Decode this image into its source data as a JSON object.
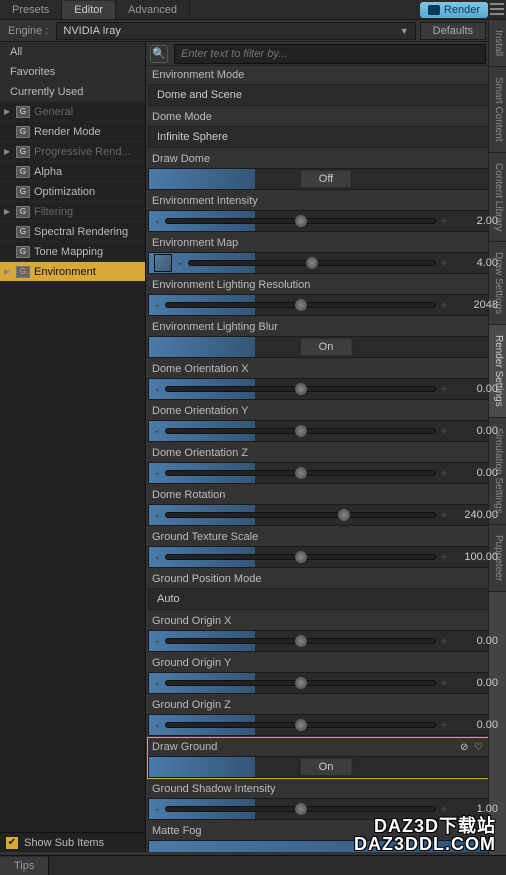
{
  "topTabs": [
    "Presets",
    "Editor",
    "Advanced"
  ],
  "activeTopTab": 1,
  "renderBtn": "Render",
  "engineLabel": "Engine :",
  "engineValue": "NVIDIA Iray",
  "defaultsBtn": "Defaults",
  "sidebar": {
    "headers": [
      "All",
      "Favorites",
      "Currently Used"
    ],
    "items": [
      {
        "label": "General",
        "dim": true,
        "expandable": true
      },
      {
        "label": "Render Mode",
        "dim": false
      },
      {
        "label": "Progressive Rend...",
        "dim": true,
        "expandable": true
      },
      {
        "label": "Alpha",
        "dim": false
      },
      {
        "label": "Optimization",
        "dim": false
      },
      {
        "label": "Filtering",
        "dim": true,
        "expandable": true
      },
      {
        "label": "Spectral Rendering",
        "dim": false
      },
      {
        "label": "Tone Mapping",
        "dim": false
      },
      {
        "label": "Environment",
        "dim": false,
        "selected": true,
        "expandable": true
      }
    ],
    "footerChk": "Show Sub Items"
  },
  "filterPlaceholder": "Enter text to filter by...",
  "params": [
    {
      "type": "select",
      "label": "Environment Mode",
      "value": "Dome and Scene"
    },
    {
      "type": "select",
      "label": "Dome Mode",
      "value": "Infinite Sphere"
    },
    {
      "type": "toggle",
      "label": "Draw Dome",
      "value": "Off"
    },
    {
      "type": "slider",
      "label": "Environment Intensity",
      "value": "2.00",
      "pos": 50
    },
    {
      "type": "slidermap",
      "label": "Environment Map",
      "value": "4.00",
      "pos": 50
    },
    {
      "type": "slider",
      "label": "Environment Lighting Resolution",
      "value": "2048",
      "pos": 50
    },
    {
      "type": "toggle",
      "label": "Environment Lighting Blur",
      "value": "On"
    },
    {
      "type": "slider",
      "label": "Dome Orientation X",
      "value": "0.00",
      "pos": 50
    },
    {
      "type": "slider",
      "label": "Dome Orientation Y",
      "value": "0.00",
      "pos": 50
    },
    {
      "type": "slider",
      "label": "Dome Orientation Z",
      "value": "0.00",
      "pos": 50
    },
    {
      "type": "slider",
      "label": "Dome Rotation",
      "value": "240.00",
      "pos": 66
    },
    {
      "type": "slider",
      "label": "Ground Texture Scale",
      "value": "100.00",
      "pos": 50
    },
    {
      "type": "select",
      "label": "Ground Position Mode",
      "value": "Auto"
    },
    {
      "type": "slider",
      "label": "Ground Origin X",
      "value": "0.00",
      "pos": 50
    },
    {
      "type": "slider",
      "label": "Ground Origin Y",
      "value": "0.00",
      "pos": 50
    },
    {
      "type": "slider",
      "label": "Ground Origin Z",
      "value": "0.00",
      "pos": 50
    },
    {
      "type": "toggle",
      "label": "Draw Ground",
      "value": "On",
      "active": true,
      "extras": true
    },
    {
      "type": "slider",
      "label": "Ground Shadow Intensity",
      "value": "1.00",
      "pos": 50
    },
    {
      "type": "full",
      "label": "Matte Fog",
      "value": ""
    }
  ],
  "rightTabs": [
    "Install",
    "Smart Content",
    "Content Library",
    "Draw Settings",
    "Render Settings",
    "Simulation Settings",
    "Puppeteer"
  ],
  "activeRightTab": 4,
  "tipsTab": "Tips",
  "watermark1": "DAZ3D下载站",
  "watermark2": "DAZ3DDL.COM"
}
